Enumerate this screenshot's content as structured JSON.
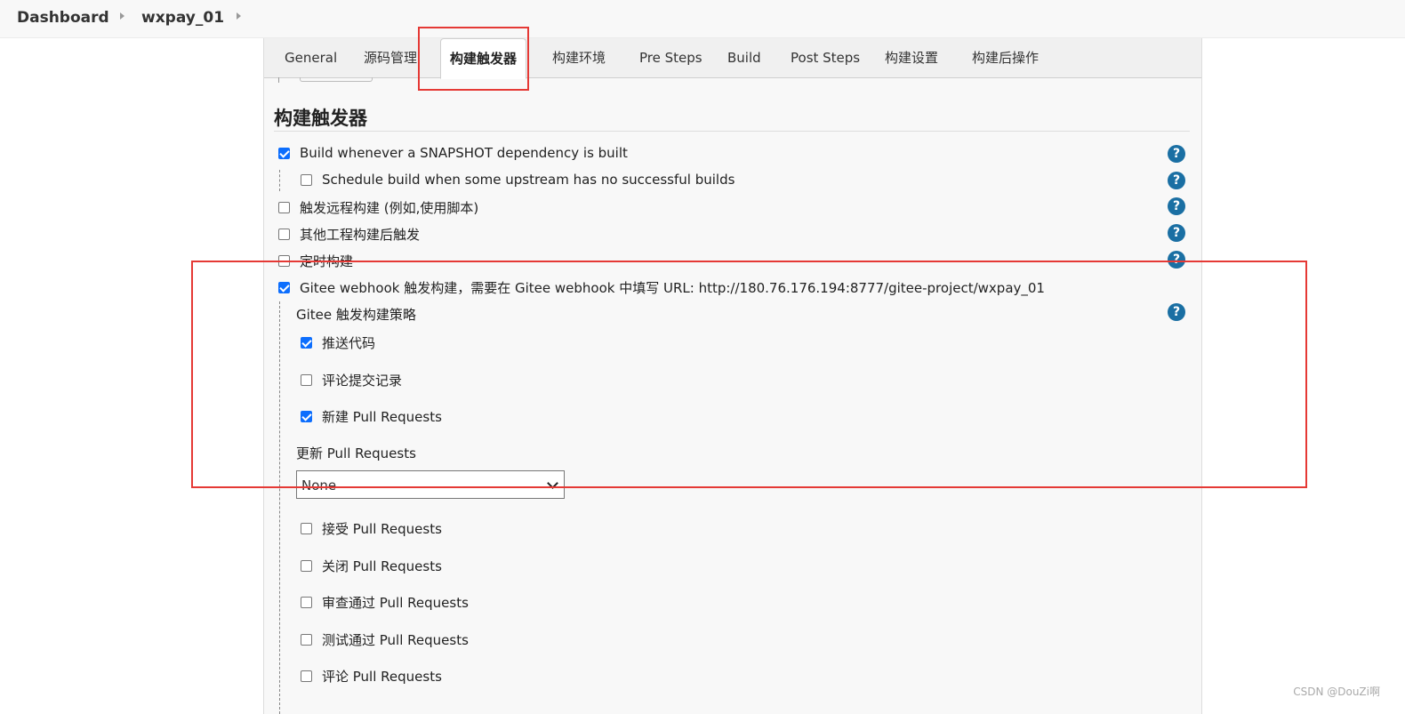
{
  "breadcrumb": {
    "items": [
      "Dashboard",
      "wxpay_01"
    ]
  },
  "tabs": [
    "General",
    "源码管理",
    "构建触发器",
    "构建环境",
    "Pre Steps",
    "Build",
    "Post Steps",
    "构建设置",
    "构建后操作"
  ],
  "active_tab": "构建触发器",
  "section": {
    "title": "构建触发器"
  },
  "triggers": {
    "snapshot": {
      "label": "Build whenever a SNAPSHOT dependency is built",
      "checked": true
    },
    "upstream": {
      "label": "Schedule build when some upstream has no successful builds",
      "checked": false
    },
    "remote": {
      "label": "触发远程构建 (例如,使用脚本)",
      "checked": false
    },
    "after_other": {
      "label": "其他工程构建后触发",
      "checked": false
    },
    "timer": {
      "label": "定时构建",
      "checked": false
    },
    "gitee": {
      "label": "Gitee webhook 触发构建，需要在 Gitee webhook 中填写 URL: http://180.76.176.194:8777/gitee-project/wxpay_01",
      "checked": true
    }
  },
  "gitee_strategy": {
    "title": "Gitee 触发构建策略",
    "push": {
      "label": "推送代码",
      "checked": true
    },
    "comment_commit": {
      "label": "评论提交记录",
      "checked": false
    },
    "new_pr": {
      "label": "新建 Pull Requests",
      "checked": true
    },
    "update_pr_label": "更新 Pull Requests",
    "update_pr_value": "None",
    "accept_pr": {
      "label": "接受 Pull Requests",
      "checked": false
    },
    "close_pr": {
      "label": "关闭 Pull Requests",
      "checked": false
    },
    "approve_pr": {
      "label": "审查通过 Pull Requests",
      "checked": false
    },
    "test_pr": {
      "label": "测试通过 Pull Requests",
      "checked": false
    },
    "comment_pr": {
      "label": "评论 Pull Requests",
      "checked": false
    }
  },
  "help_symbol": "?",
  "watermark": "CSDN @DouZi啊",
  "colors": {
    "accent": "#0d6efd",
    "help": "#1a6fa3",
    "annotation": "#e53935"
  },
  "icons": {
    "help": "help-icon",
    "chevron": "chevron-down-icon",
    "separator": "breadcrumb-separator-icon"
  }
}
